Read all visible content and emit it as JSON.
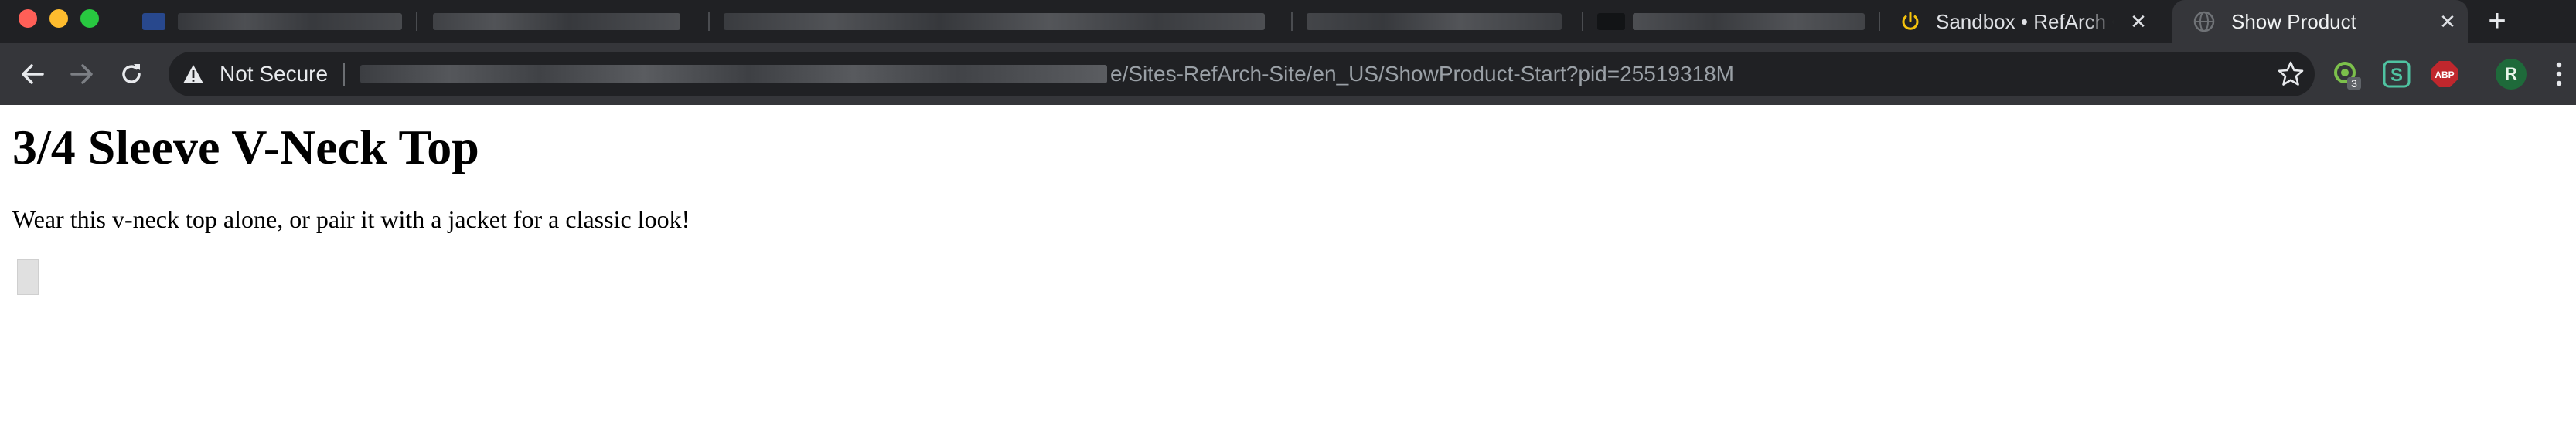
{
  "window": {
    "controls": [
      "close",
      "minimize",
      "zoom"
    ]
  },
  "tabs": {
    "sandbox": {
      "title": "Sandbox • RefArch • B",
      "favicon": "power-icon"
    },
    "active": {
      "title": "Show Product",
      "favicon": "globe-icon"
    },
    "new_tab_label": "+"
  },
  "toolbar": {
    "security_label": "Not Secure",
    "url_visible": "e/Sites-RefArch-Site/en_US/ShowProduct-Start?pid=25519318M",
    "extensions": [
      {
        "name": "circle-badge-extension",
        "badge": "3"
      },
      {
        "name": "s-extension",
        "label": "S"
      },
      {
        "name": "adblock-plus-extension",
        "label": "ABP"
      }
    ],
    "profile_initial": "R"
  },
  "page": {
    "product_title": "3/4 Sleeve V-Neck Top",
    "product_description": "Wear this v-neck top alone, or pair it with a jacket for a classic look!"
  },
  "colors": {
    "tabstrip": "#202124",
    "toolbar": "#35363a",
    "page_bg": "#ffffff",
    "profile": "#1e6a3a",
    "abp": "#c0272d"
  }
}
